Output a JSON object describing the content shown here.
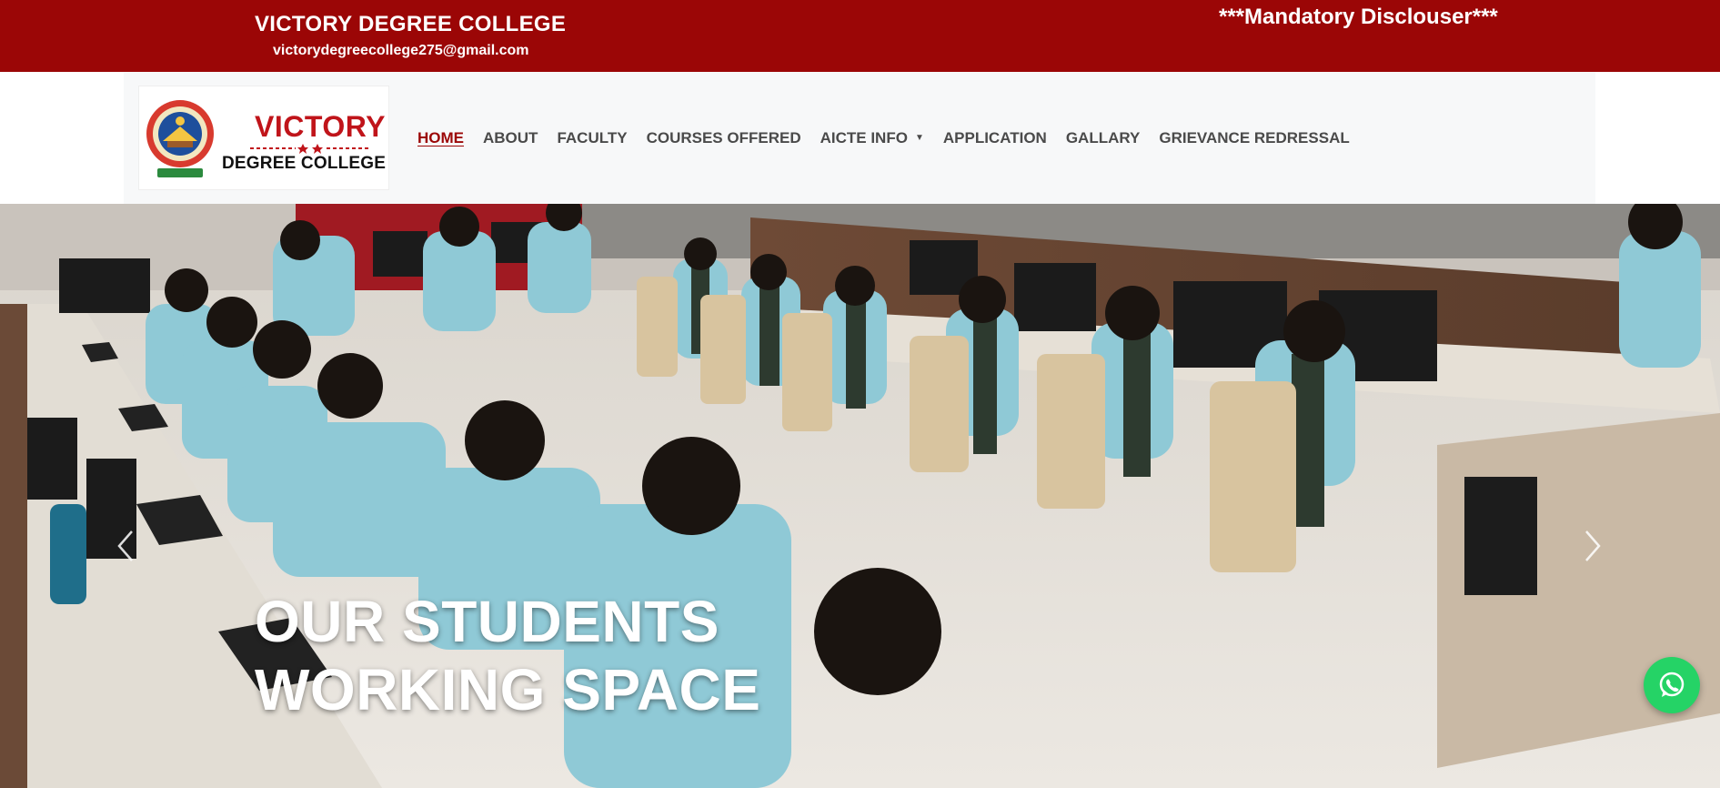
{
  "topbar": {
    "college_name": "VICTORY DEGREE COLLEGE",
    "email": "victorydegreecollege275@gmail.com",
    "mandatory_link": "***Mandatory Disclouser***",
    "background_color": "#9b0606"
  },
  "logo": {
    "title": "VICTORY",
    "subtitle": "DEGREE COLLEGE",
    "icon": "college-seal-icon"
  },
  "nav": {
    "items": [
      {
        "label": "HOME",
        "active": true
      },
      {
        "label": "ABOUT"
      },
      {
        "label": "FACULTY"
      },
      {
        "label": "COURSES OFFERED"
      },
      {
        "label": "AICTE INFO",
        "has_dropdown": true
      },
      {
        "label": "APPLICATION"
      },
      {
        "label": "GALLARY"
      },
      {
        "label": "GRIEVANCE REDRESSAL"
      }
    ],
    "active_color": "#9b0606"
  },
  "hero": {
    "caption_line1": "OUR STUDENTS",
    "caption_line2": "WORKING SPACE",
    "prev_icon": "chevron-left-icon",
    "next_icon": "chevron-right-icon"
  },
  "whatsapp": {
    "icon": "whatsapp-icon",
    "color": "#25d366"
  }
}
